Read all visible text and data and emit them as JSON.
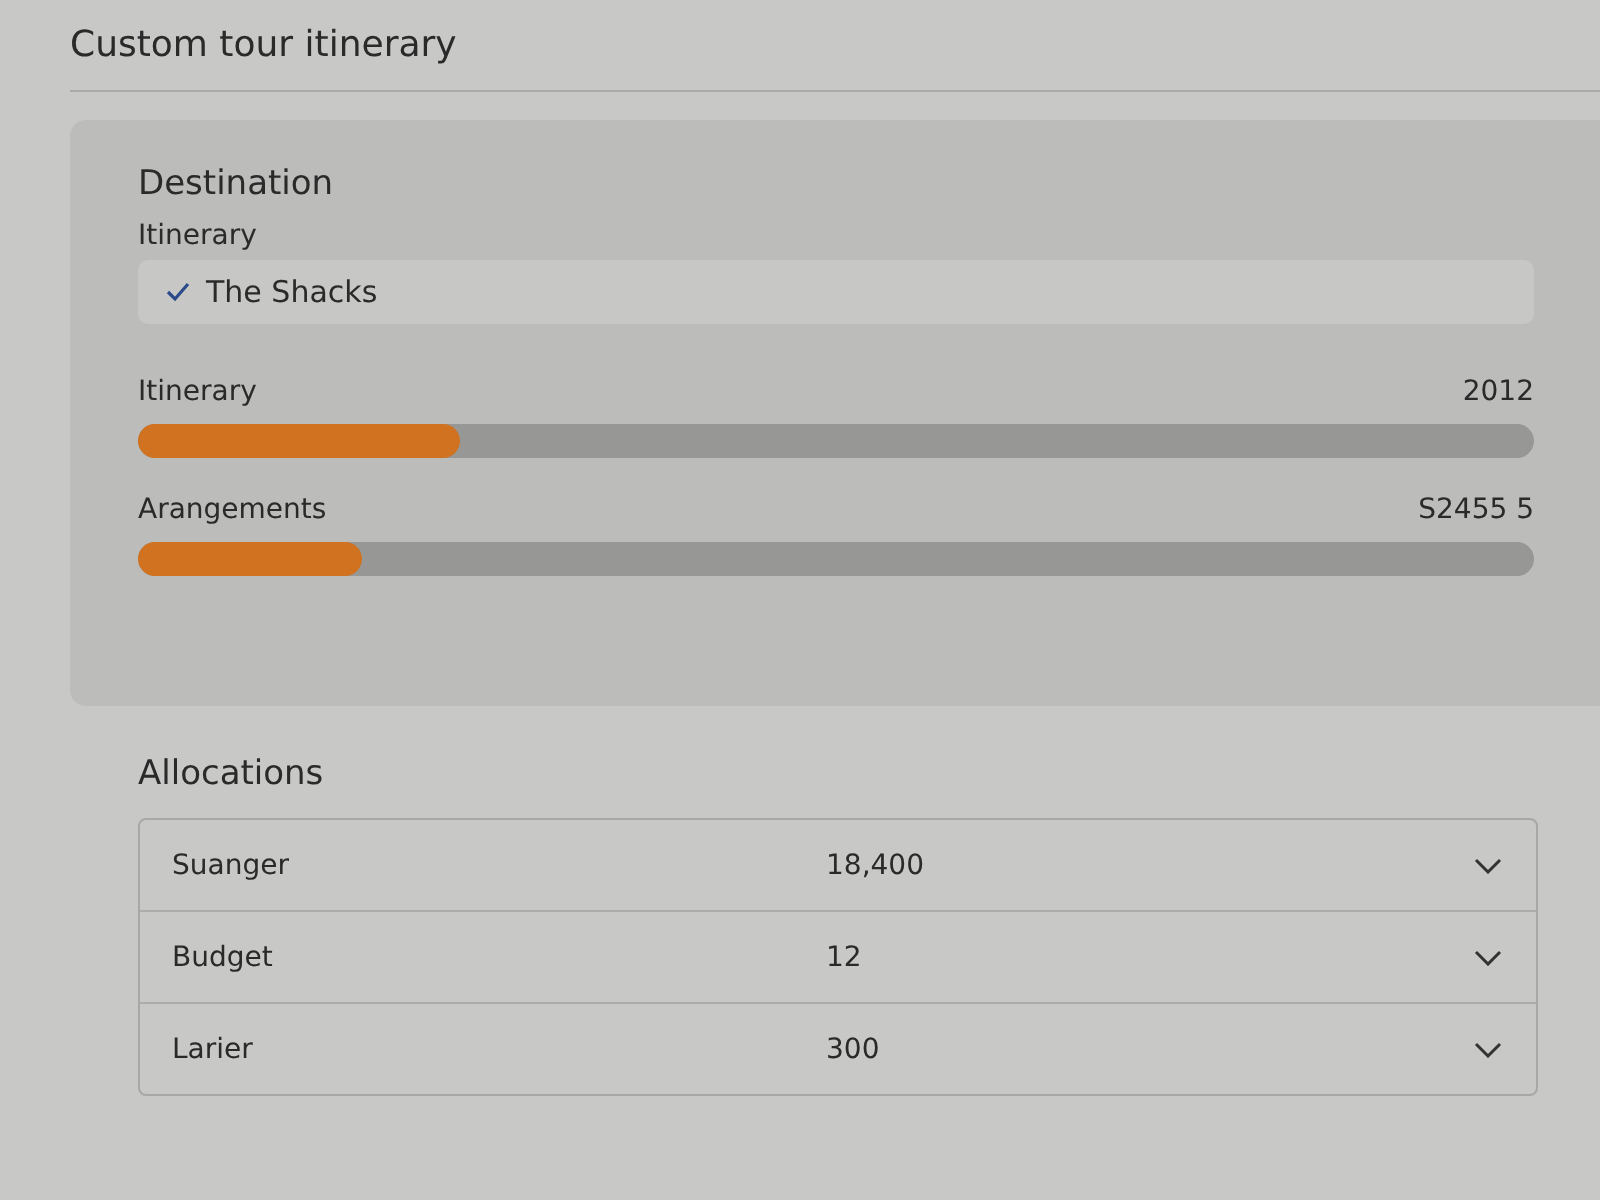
{
  "header": {
    "title": "Custom tour itinerary"
  },
  "destination": {
    "heading": "Destination",
    "label": "Itinerary",
    "field_value": "The Shacks"
  },
  "meters": [
    {
      "label": "Itinerary",
      "reading": "2012",
      "level": 0.23
    },
    {
      "label": "Arangements",
      "reading": "S2455 5",
      "level": 0.16
    }
  ],
  "allocations": {
    "heading": "Allocations",
    "rows": [
      {
        "name": "Suanger",
        "value": "18,400"
      },
      {
        "name": "Budget",
        "value": "12"
      },
      {
        "name": "Larier",
        "value": "300"
      }
    ]
  }
}
